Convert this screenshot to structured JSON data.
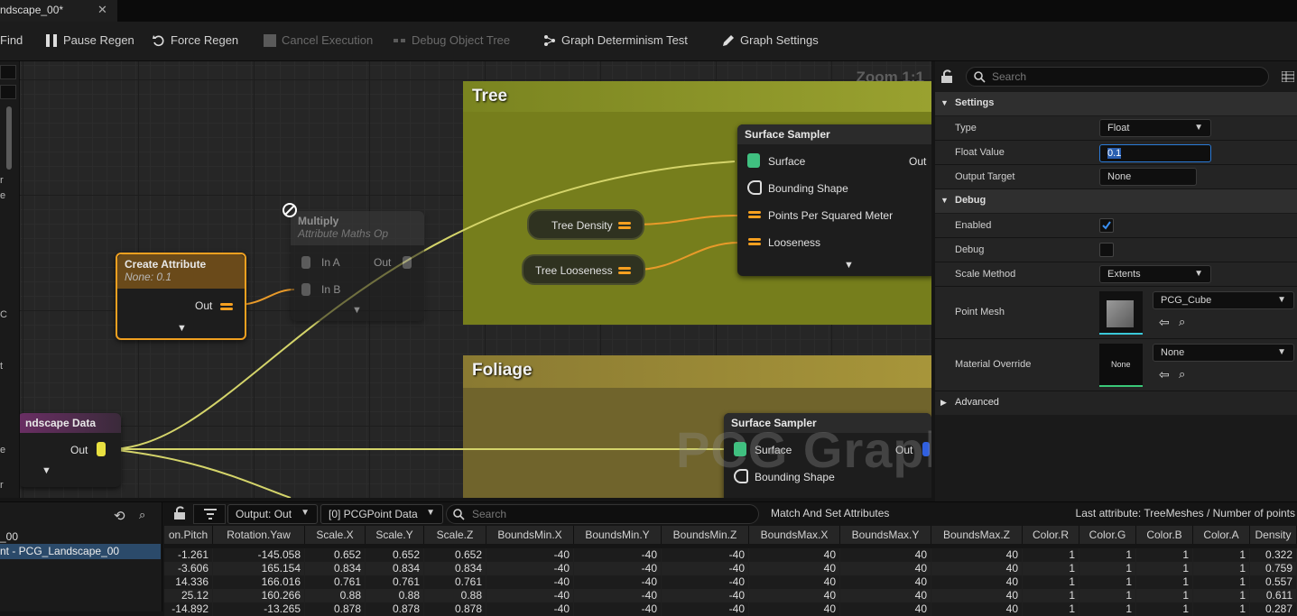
{
  "tab": {
    "title": "ndscape_00*",
    "close": "✕"
  },
  "toolbar": {
    "find": "Find",
    "pause_regen": "Pause Regen",
    "force_regen": "Force Regen",
    "cancel_execution": "Cancel Execution",
    "debug_object_tree": "Debug Object Tree",
    "determinism_test": "Graph Determinism Test",
    "graph_settings": "Graph Settings"
  },
  "left_strip": {
    "chars": [
      "r",
      "e",
      "C",
      "t",
      "e",
      "r"
    ]
  },
  "canvas": {
    "zoom": "Zoom 1:1",
    "watermark": "PCG Graph",
    "comments": {
      "tree": "Tree",
      "foliage": "Foliage"
    },
    "nodes": {
      "create_attribute": {
        "title": "Create Attribute",
        "subtitle": "None: 0.1",
        "out": "Out"
      },
      "multiply": {
        "title": "Multiply",
        "subtitle": "Attribute Maths Op",
        "in_a": "In A",
        "in_b": "In B",
        "out": "Out"
      },
      "landscape": {
        "title": "ndscape Data",
        "out": "Out"
      },
      "tree_density": {
        "label": "Tree Density"
      },
      "tree_looseness": {
        "label": "Tree Looseness"
      },
      "surface_sampler_tree": {
        "title": "Surface Sampler",
        "pins": [
          "Surface",
          "Bounding Shape",
          "Points Per Squared Meter",
          "Looseness"
        ],
        "out": "Out"
      },
      "surface_sampler_foliage": {
        "title": "Surface Sampler",
        "pins": [
          "Surface",
          "Bounding Shape"
        ],
        "out": "Out"
      }
    }
  },
  "details": {
    "search_placeholder": "Search",
    "sections": {
      "settings": "Settings",
      "debug": "Debug",
      "advanced": "Advanced"
    },
    "props": {
      "type": {
        "label": "Type",
        "value": "Float"
      },
      "float_value": {
        "label": "Float Value",
        "value": "0.1"
      },
      "output_target": {
        "label": "Output Target",
        "value": "None"
      },
      "enabled": {
        "label": "Enabled",
        "checked": true
      },
      "debug": {
        "label": "Debug",
        "checked": false
      },
      "scale_method": {
        "label": "Scale Method",
        "value": "Extents"
      },
      "point_mesh": {
        "label": "Point Mesh",
        "value": "PCG_Cube"
      },
      "material_override": {
        "label": "Material Override",
        "value": "None",
        "thumb": "None"
      }
    }
  },
  "bottom": {
    "left_items": [
      "_00",
      "nt - PCG_Landscape_00"
    ],
    "output_combo": "Output: Out",
    "data_combo": "[0] PCGPoint Data",
    "search_placeholder": "Search",
    "match_label": "Match And Set Attributes",
    "last_attribute": "Last attribute: TreeMeshes / Number of points",
    "columns": [
      "on.Pitch",
      "Rotation.Yaw",
      "Scale.X",
      "Scale.Y",
      "Scale.Z",
      "BoundsMin.X",
      "BoundsMin.Y",
      "BoundsMin.Z",
      "BoundsMax.X",
      "BoundsMax.Y",
      "BoundsMax.Z",
      "Color.R",
      "Color.G",
      "Color.B",
      "Color.A",
      "Density"
    ],
    "rows": [
      [
        "-1.261",
        "-145.058",
        "0.652",
        "0.652",
        "0.652",
        "-40",
        "-40",
        "-40",
        "40",
        "40",
        "40",
        "1",
        "1",
        "1",
        "1",
        "0.322"
      ],
      [
        "-3.606",
        "165.154",
        "0.834",
        "0.834",
        "0.834",
        "-40",
        "-40",
        "-40",
        "40",
        "40",
        "40",
        "1",
        "1",
        "1",
        "1",
        "0.759"
      ],
      [
        "14.336",
        "166.016",
        "0.761",
        "0.761",
        "0.761",
        "-40",
        "-40",
        "-40",
        "40",
        "40",
        "40",
        "1",
        "1",
        "1",
        "1",
        "0.557"
      ],
      [
        "25.12",
        "160.266",
        "0.88",
        "0.88",
        "0.88",
        "-40",
        "-40",
        "-40",
        "40",
        "40",
        "40",
        "1",
        "1",
        "1",
        "1",
        "0.611"
      ],
      [
        "-14.892",
        "-13.265",
        "0.878",
        "0.878",
        "0.878",
        "-40",
        "-40",
        "-40",
        "40",
        "40",
        "40",
        "1",
        "1",
        "1",
        "1",
        "0.287"
      ]
    ]
  }
}
